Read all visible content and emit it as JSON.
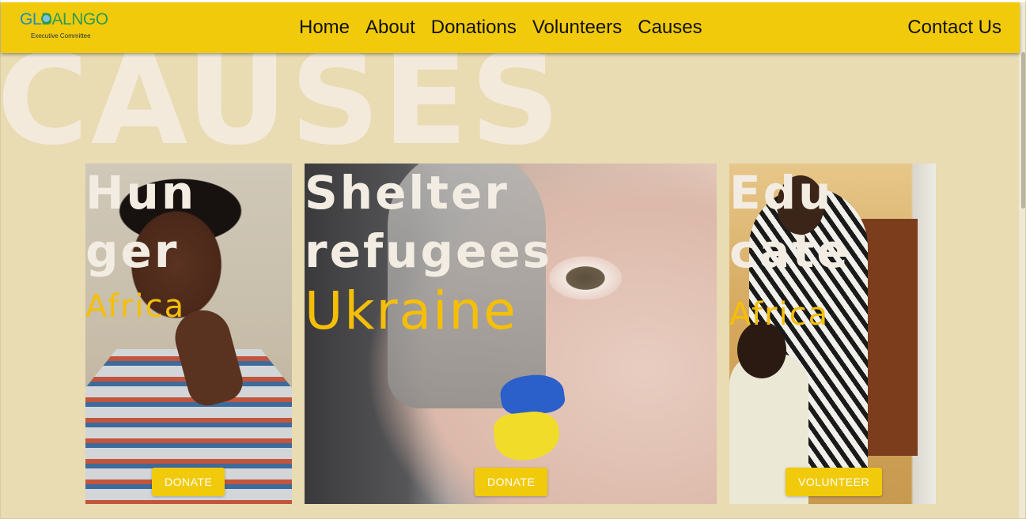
{
  "brand": {
    "logo_part1": "GL",
    "logo_part2": "BALNGO",
    "tagline": "Executive Committee"
  },
  "nav": {
    "items": [
      "Home",
      "About",
      "Donations",
      "Volunteers",
      "Causes"
    ],
    "contact": "Contact Us"
  },
  "hero": {
    "word": "CAUSES"
  },
  "cards": [
    {
      "title_line1": "Hun",
      "title_line2": "ger",
      "region": "Africa",
      "button": "DONATE"
    },
    {
      "title_line1": "Shelter",
      "title_line2": "refugees",
      "region": "Ukraine",
      "button": "DONATE"
    },
    {
      "title_line1": "Edu",
      "title_line2": "cate",
      "region": "Africa",
      "button": "VOLUNTEER"
    }
  ],
  "colors": {
    "header": "#f1ca0b",
    "background": "#e9dbb2",
    "accent_text": "#f5bf07",
    "hero_text": "#f3eadb"
  }
}
